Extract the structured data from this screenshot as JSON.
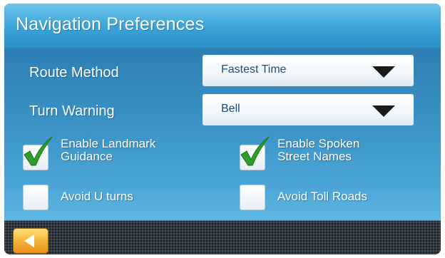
{
  "header": {
    "title": "Navigation Preferences"
  },
  "route_method": {
    "label": "Route Method",
    "value": "Fastest Time"
  },
  "turn_warning": {
    "label": "Turn Warning",
    "value": "Bell"
  },
  "options": {
    "landmark_guidance": {
      "label_line1": "Enable Landmark",
      "label_line2": "Guidance",
      "checked": true
    },
    "spoken_street_names": {
      "label_line1": "Enable Spoken",
      "label_line2": "Street Names",
      "checked": true
    },
    "avoid_u_turns": {
      "label": "Avoid U turns",
      "checked": false
    },
    "avoid_toll_roads": {
      "label": "Avoid Toll Roads",
      "checked": false
    }
  },
  "colors": {
    "title_bar": "#3aa3d6",
    "content_bg": "#3b93c6",
    "checkmark": "#2e9e2a",
    "back_button": "#f5b43a"
  },
  "icons": {
    "back": "left-arrow-icon",
    "dropdown": "chevron-down-icon",
    "check": "checkmark-icon"
  }
}
